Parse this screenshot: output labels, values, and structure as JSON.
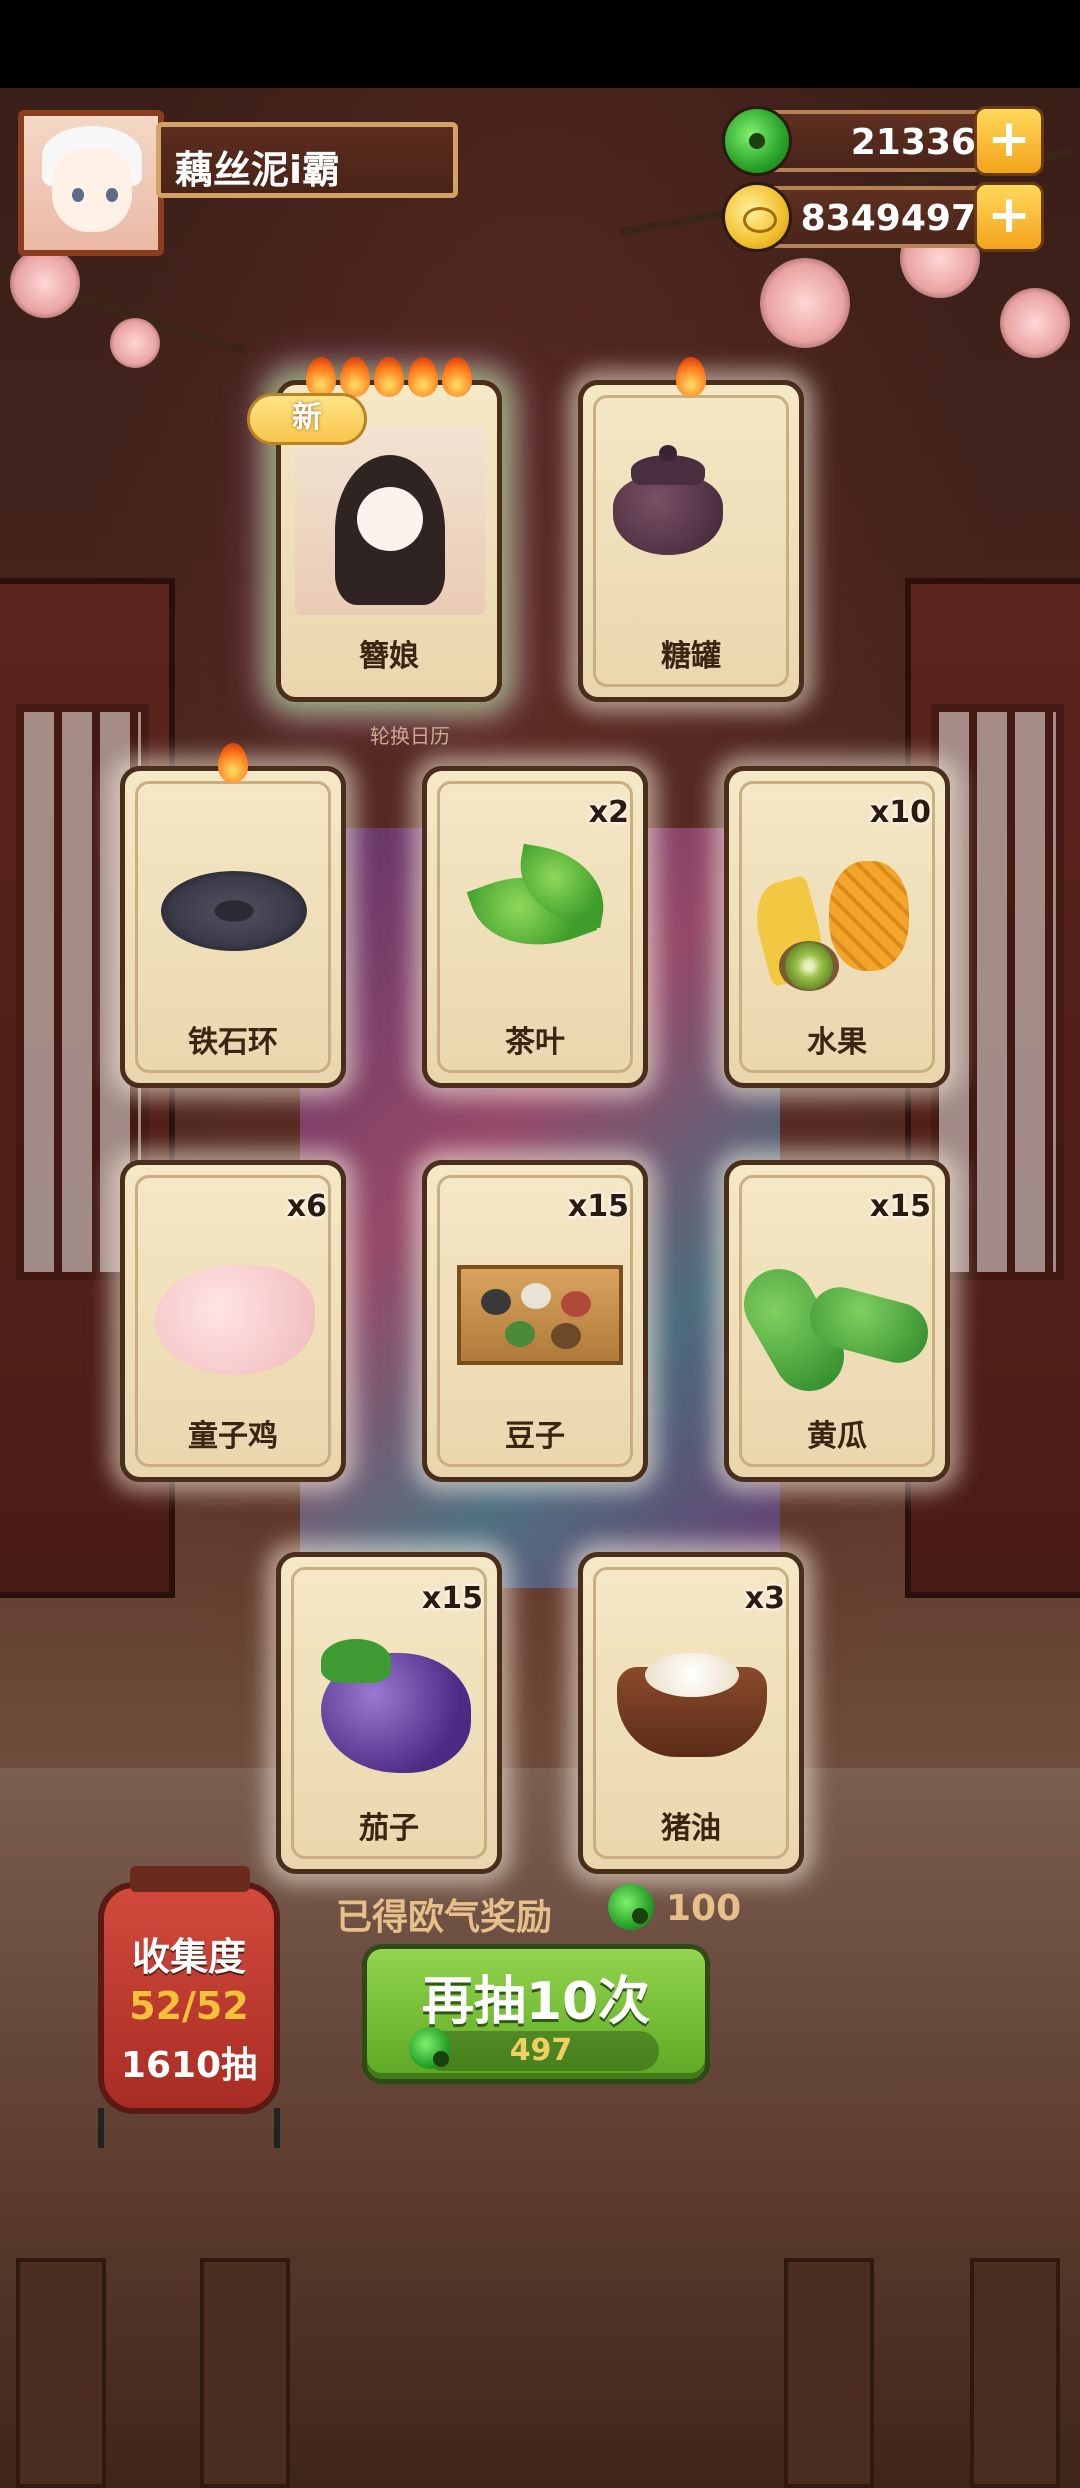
{
  "player": {
    "name": "藕丝泥i霸"
  },
  "currencies": {
    "jade": {
      "icon": "jade-icon",
      "value": "21336"
    },
    "coin": {
      "icon": "coin-icon",
      "value": "8349497"
    }
  },
  "cards": [
    {
      "name": "簪娘",
      "count": "",
      "flames": 5,
      "is_new": true,
      "new_label": "新"
    },
    {
      "name": "糖罐",
      "count": "",
      "flames": 1
    },
    {
      "name": "铁石环",
      "count": "",
      "flames": 1
    },
    {
      "name": "茶叶",
      "count": "x2",
      "flames": 0
    },
    {
      "name": "水果",
      "count": "x10",
      "flames": 0
    },
    {
      "name": "童子鸡",
      "count": "x6",
      "flames": 0
    },
    {
      "name": "豆子",
      "count": "x15",
      "flames": 0
    },
    {
      "name": "黄瓜",
      "count": "x15",
      "flames": 0
    },
    {
      "name": "茄子",
      "count": "x15",
      "flames": 0
    },
    {
      "name": "猪油",
      "count": "x3",
      "flames": 0
    }
  ],
  "calendar_caption": "轮换日历",
  "reward": {
    "label": "已得欧气奖励",
    "value": "100"
  },
  "draw_button": {
    "label": "再抽10次",
    "cost": "497"
  },
  "collection": {
    "title": "收集度",
    "progress": "52/52",
    "draws": "1610抽"
  }
}
